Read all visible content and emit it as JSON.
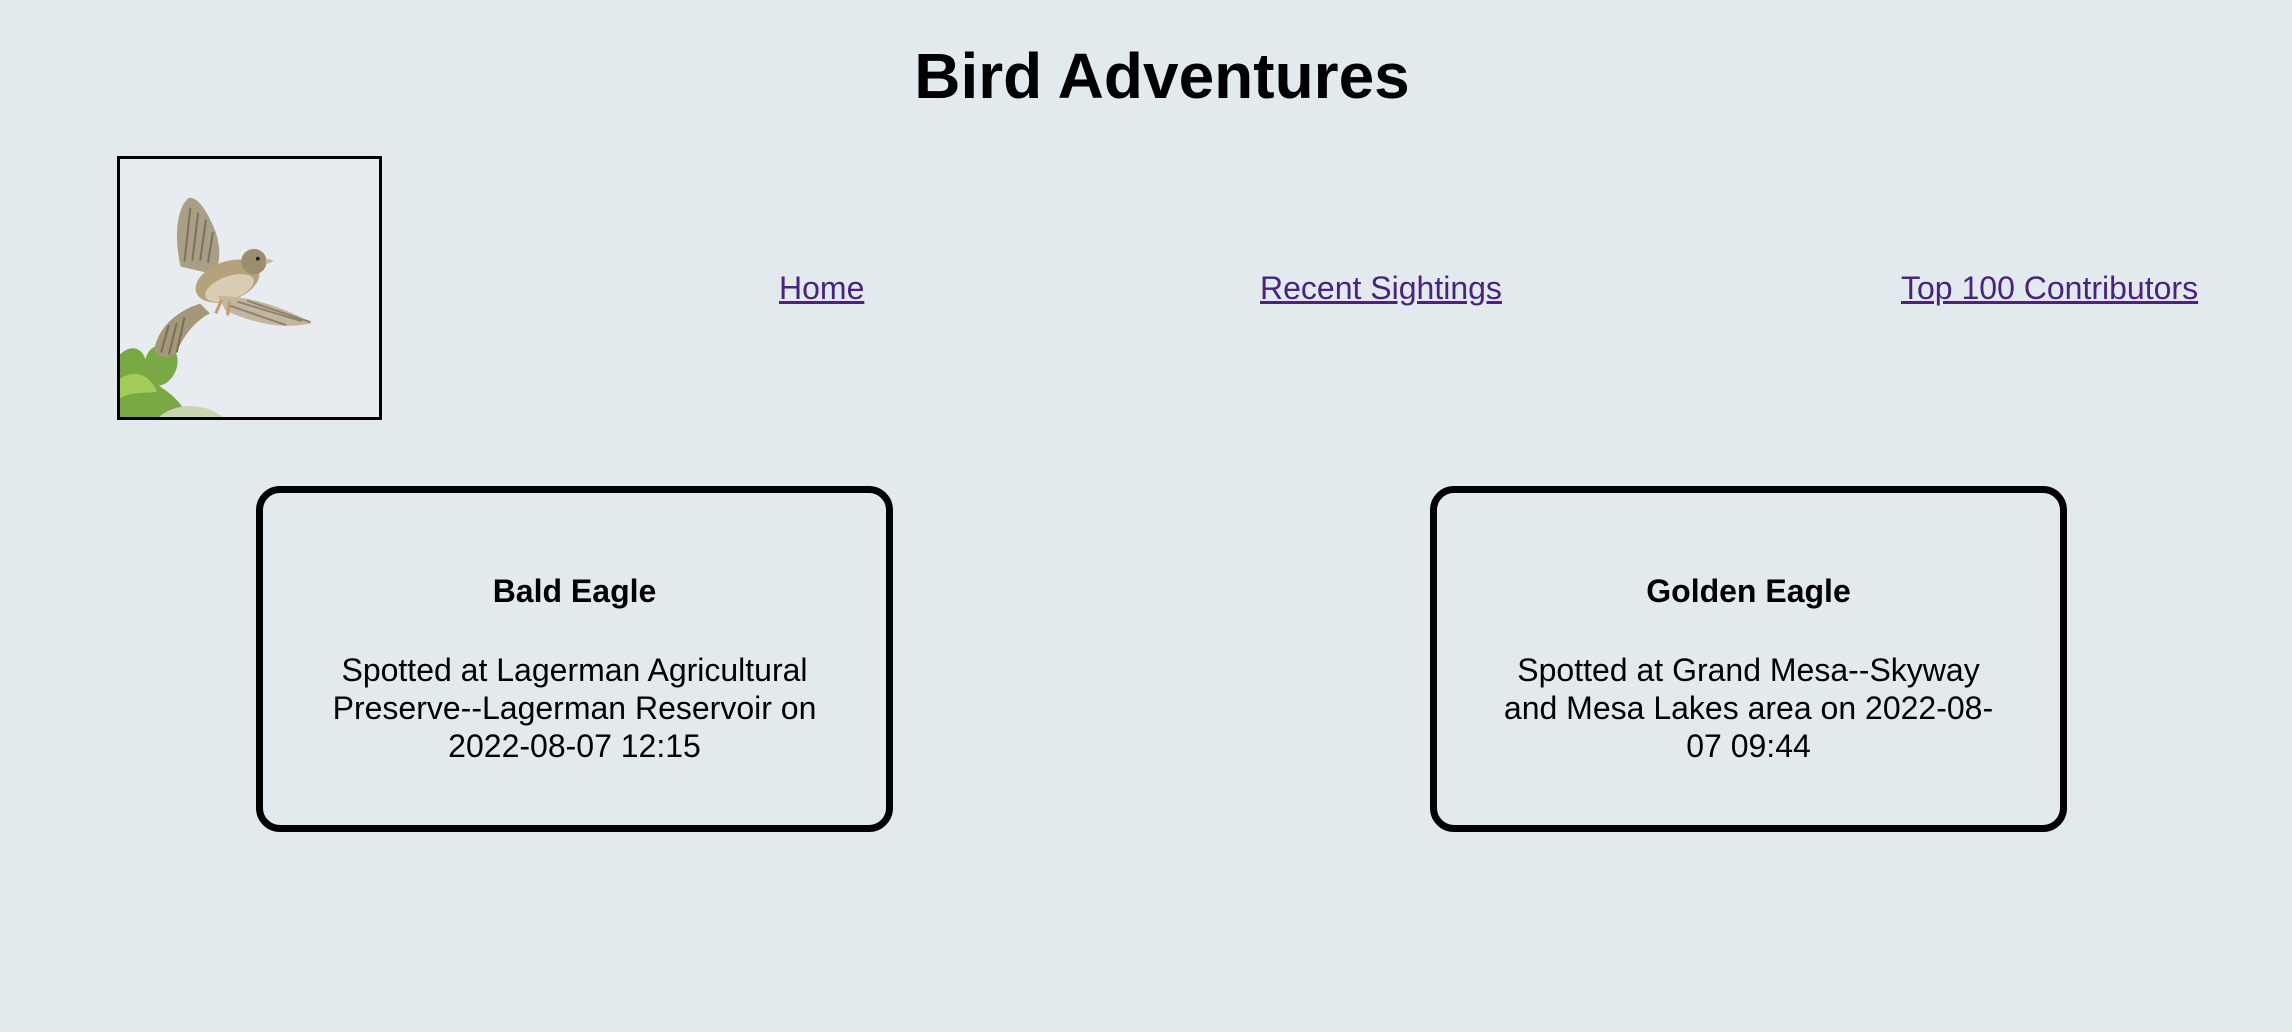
{
  "header": {
    "title": "Bird Adventures"
  },
  "logo": {
    "icon": "sparrow-in-flight-image"
  },
  "nav": {
    "home": "Home",
    "recent": "Recent Sightings",
    "top": "Top 100 Contributors"
  },
  "sightings": [
    {
      "bird": "Bald Eagle",
      "description": "Spotted at Lagerman Agricultural Preserve--Lagerman Reservoir on 2022-08-07 12:15"
    },
    {
      "bird": "Golden Eagle",
      "description": "Spotted at Grand Mesa--Skyway and Mesa Lakes area on 2022-08-07 09:44"
    }
  ],
  "colors": {
    "background": "#e3eaee",
    "link": "#4a2381",
    "border": "#000000"
  }
}
